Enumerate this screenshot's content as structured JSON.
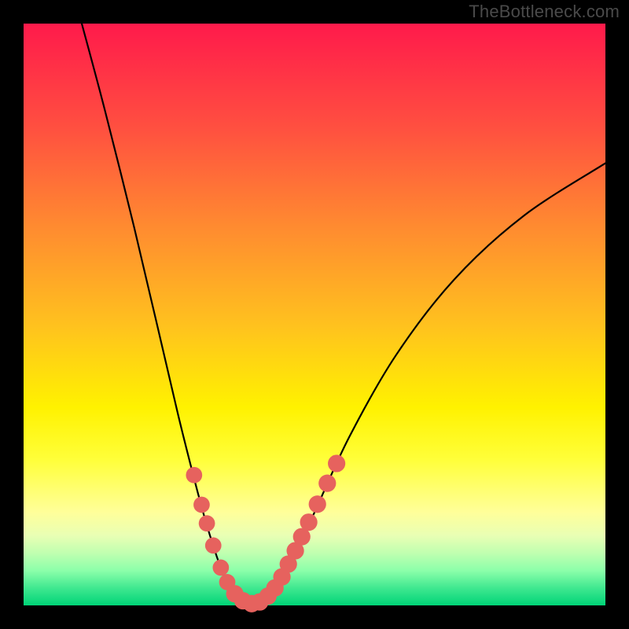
{
  "watermark": "TheBottleneck.com",
  "chart_data": {
    "type": "line",
    "title": "",
    "xlabel": "",
    "ylabel": "",
    "xlim": [
      0,
      100
    ],
    "ylim": [
      0,
      100
    ],
    "series": [
      {
        "name": "curve",
        "points": [
          {
            "x": 10,
            "y": 100
          },
          {
            "x": 14,
            "y": 85
          },
          {
            "x": 19,
            "y": 65
          },
          {
            "x": 23,
            "y": 48
          },
          {
            "x": 26.5,
            "y": 33
          },
          {
            "x": 29,
            "y": 23
          },
          {
            "x": 31,
            "y": 15.5
          },
          {
            "x": 33,
            "y": 9
          },
          {
            "x": 34.5,
            "y": 5
          },
          {
            "x": 36,
            "y": 2.4
          },
          {
            "x": 37.3,
            "y": 0.9
          },
          {
            "x": 38.6,
            "y": 0.3
          },
          {
            "x": 40,
            "y": 0.3
          },
          {
            "x": 41.5,
            "y": 1.0
          },
          {
            "x": 43.5,
            "y": 3.2
          },
          {
            "x": 46,
            "y": 7.5
          },
          {
            "x": 50,
            "y": 16
          },
          {
            "x": 56,
            "y": 29
          },
          {
            "x": 64,
            "y": 43
          },
          {
            "x": 74,
            "y": 56
          },
          {
            "x": 86,
            "y": 67
          },
          {
            "x": 100,
            "y": 76
          }
        ]
      }
    ],
    "markers": [
      {
        "x": 29.3,
        "y": 22.4,
        "r": 1.4
      },
      {
        "x": 30.6,
        "y": 17.3,
        "r": 1.4
      },
      {
        "x": 31.5,
        "y": 14.1,
        "r": 1.4
      },
      {
        "x": 32.6,
        "y": 10.3,
        "r": 1.4
      },
      {
        "x": 33.9,
        "y": 6.5,
        "r": 1.4
      },
      {
        "x": 35.0,
        "y": 4.0,
        "r": 1.4
      },
      {
        "x": 36.3,
        "y": 2.0,
        "r": 1.5
      },
      {
        "x": 37.7,
        "y": 0.8,
        "r": 1.5
      },
      {
        "x": 39.2,
        "y": 0.3,
        "r": 1.5
      },
      {
        "x": 40.6,
        "y": 0.6,
        "r": 1.5
      },
      {
        "x": 42.0,
        "y": 1.6,
        "r": 1.5
      },
      {
        "x": 43.2,
        "y": 3.0,
        "r": 1.5
      },
      {
        "x": 44.4,
        "y": 4.9,
        "r": 1.5
      },
      {
        "x": 45.5,
        "y": 7.1,
        "r": 1.5
      },
      {
        "x": 46.7,
        "y": 9.4,
        "r": 1.5
      },
      {
        "x": 47.8,
        "y": 11.8,
        "r": 1.5
      },
      {
        "x": 49.0,
        "y": 14.3,
        "r": 1.5
      },
      {
        "x": 50.5,
        "y": 17.4,
        "r": 1.5
      },
      {
        "x": 52.2,
        "y": 21.0,
        "r": 1.5
      },
      {
        "x": 53.8,
        "y": 24.4,
        "r": 1.5
      }
    ],
    "marker_color": "#e6625e",
    "curve_color": "#000000"
  }
}
